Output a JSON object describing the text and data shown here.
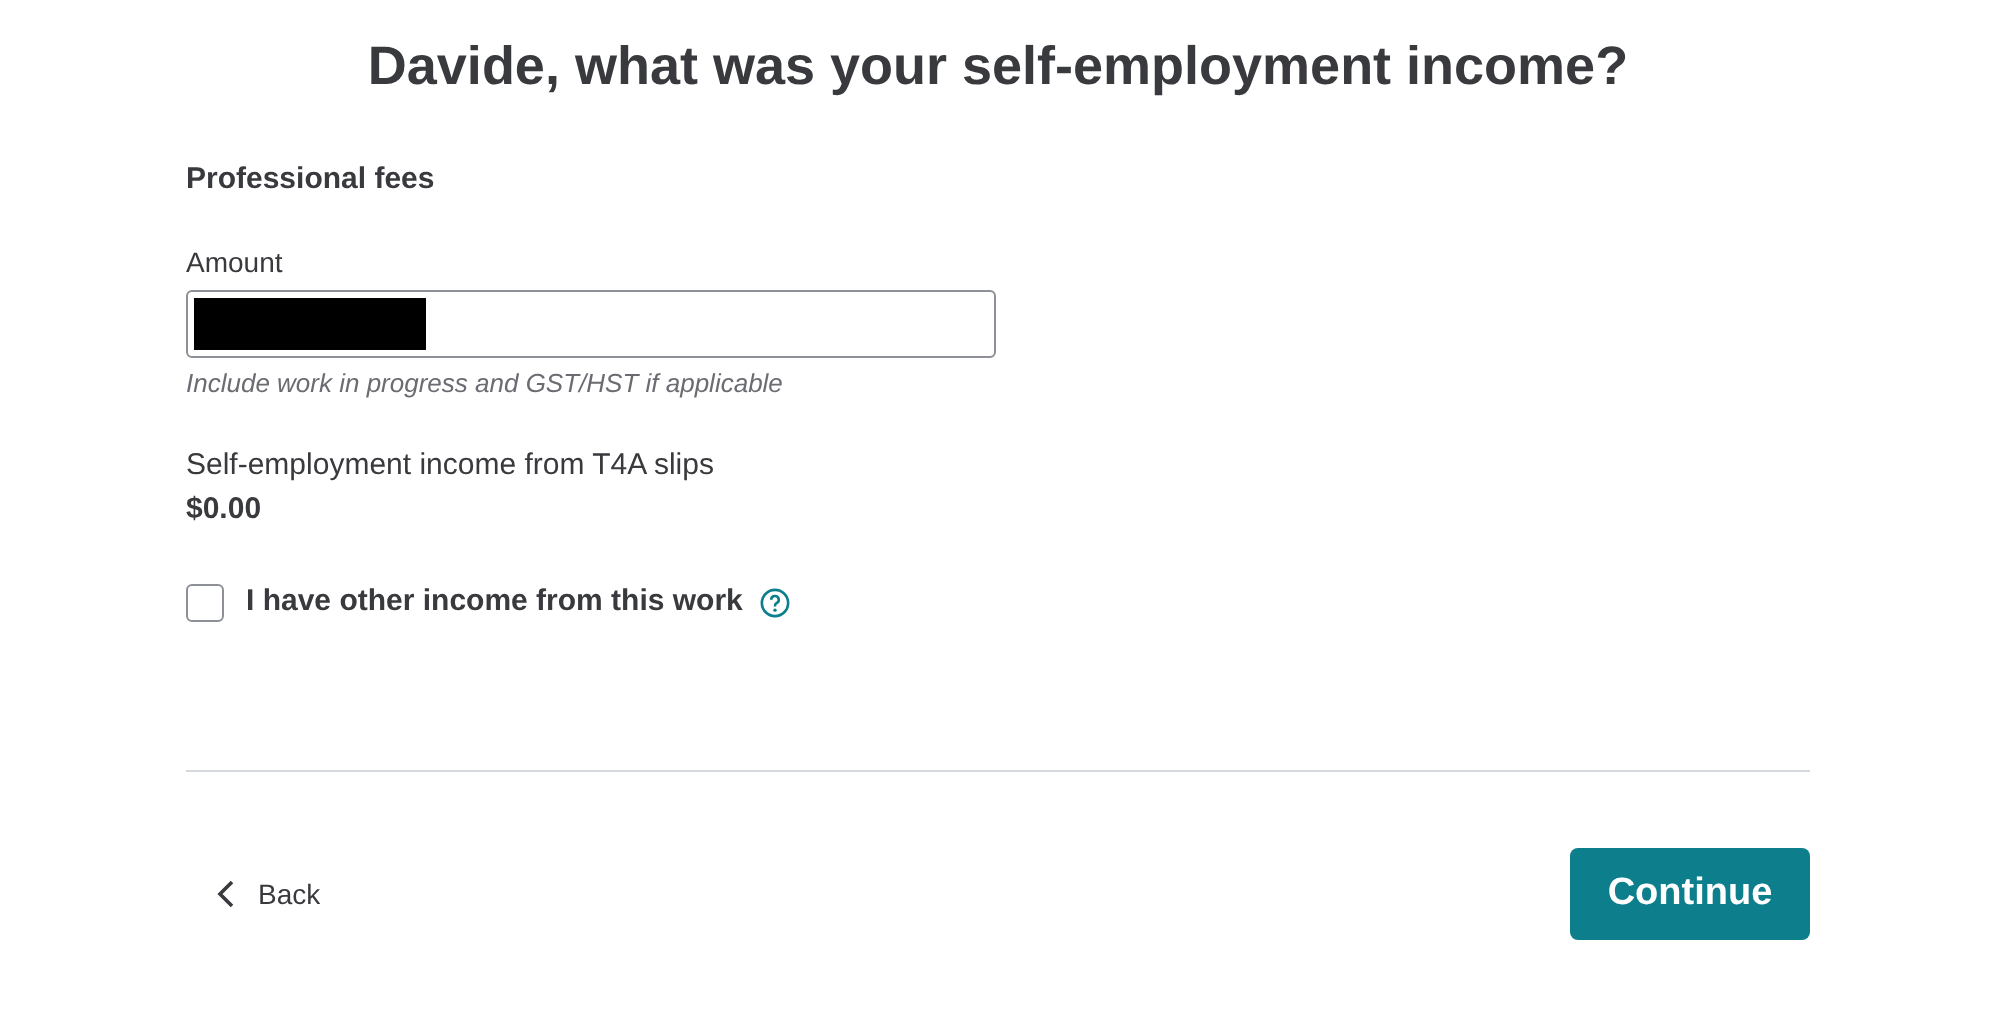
{
  "heading": "Davide, what was your self-employment income?",
  "section_title": "Professional fees",
  "amount_field": {
    "label": "Amount",
    "redacted": true,
    "hint": "Include work in progress and GST/HST if applicable"
  },
  "t4a": {
    "label": "Self-employment income from T4A slips",
    "value": "$0.00"
  },
  "other_income": {
    "label": "I have other income from this work",
    "checked": false
  },
  "back_link": "Back",
  "continue_button": "Continue"
}
